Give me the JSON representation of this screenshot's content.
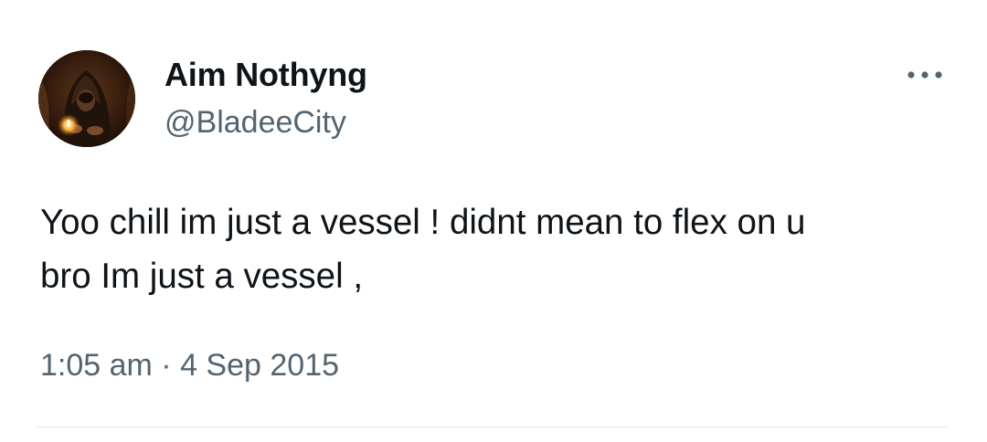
{
  "author": {
    "display_name": "Aim Nothyng",
    "handle": "@BladeeCity"
  },
  "tweet": {
    "text": "Yoo chill im just a vessel ! didnt mean to flex on u\nbro Im just a vessel ,",
    "time": "1:05 am",
    "separator": " · ",
    "date": "4 Sep 2015"
  },
  "icons": {
    "more": "more-horizontal-icon",
    "avatar": "hooded-figure-avatar"
  },
  "colors": {
    "text_primary": "#0f1419",
    "text_secondary": "#536471",
    "divider": "#e1e8ed"
  }
}
